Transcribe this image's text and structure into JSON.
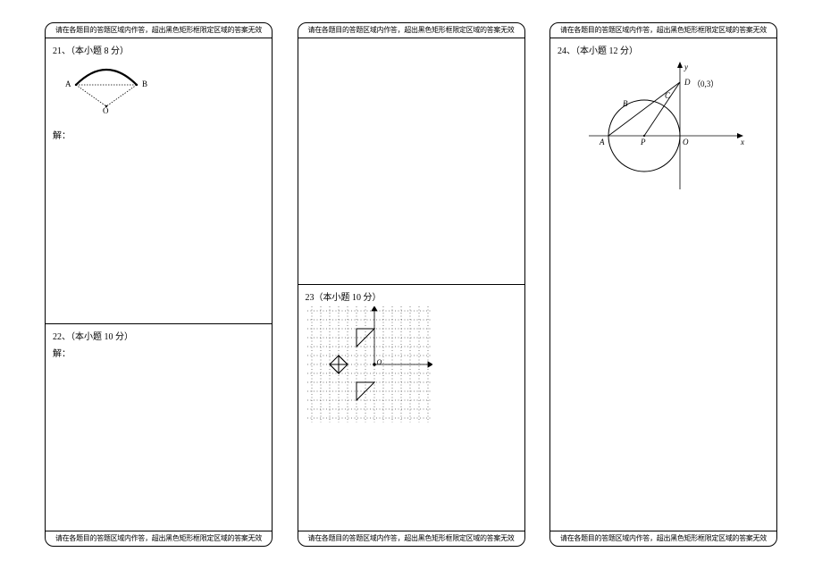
{
  "warning": "请在各题目的答题区域内作答，超出黑色矩形框限定区域的答案无效",
  "q21": {
    "title": "21、（本小题 8 分）",
    "solve": "解：",
    "labels": {
      "A": "A",
      "B": "B",
      "O": "O"
    }
  },
  "q22": {
    "title": "22、（本小题 10 分）",
    "solve": "解："
  },
  "q23": {
    "title": "23（本小题 10 分）",
    "labels": {
      "O": "O"
    }
  },
  "q24": {
    "title": "24、（本小题 12 分）",
    "labels": {
      "y": "y",
      "x": "x",
      "D": "D",
      "Dcoord": "（0,3）",
      "C": "C",
      "B": "B",
      "A": "A",
      "P": "P",
      "O": "O"
    }
  }
}
